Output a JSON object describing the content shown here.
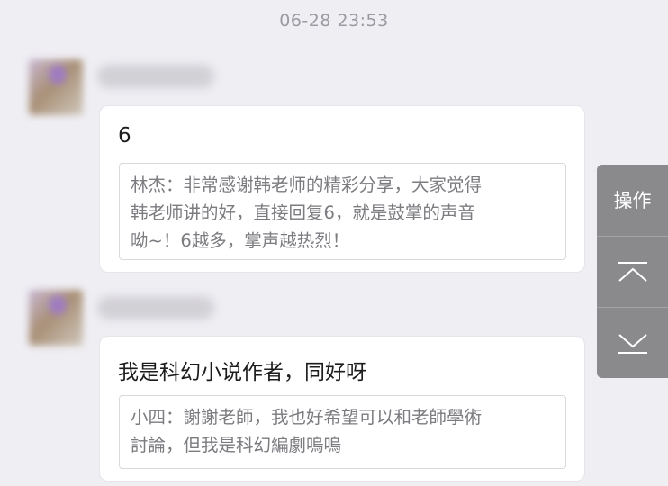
{
  "timestamp": "06-28 23:53",
  "messages": [
    {
      "text": "6",
      "quote": "林杰：非常感谢韩老师的精彩分享，大家觉得\n韩老师讲的好，直接回复6，就是鼓掌的声音\n呦~！6越多，掌声越热烈！"
    },
    {
      "text": "我是科幻小说作者，同好呀",
      "quote": "小四：謝謝老師，我也好希望可以和老師學術\n討論，但我是科幻編劇嗚嗚"
    }
  ],
  "side_panel": {
    "operate_label": "操作",
    "scroll_top_icon": "chevron-up-bar-icon",
    "scroll_bottom_icon": "chevron-down-bar-icon"
  },
  "colors": {
    "background": "#efeef3",
    "bubble": "#ffffff",
    "panel": "#8a8a8d"
  }
}
